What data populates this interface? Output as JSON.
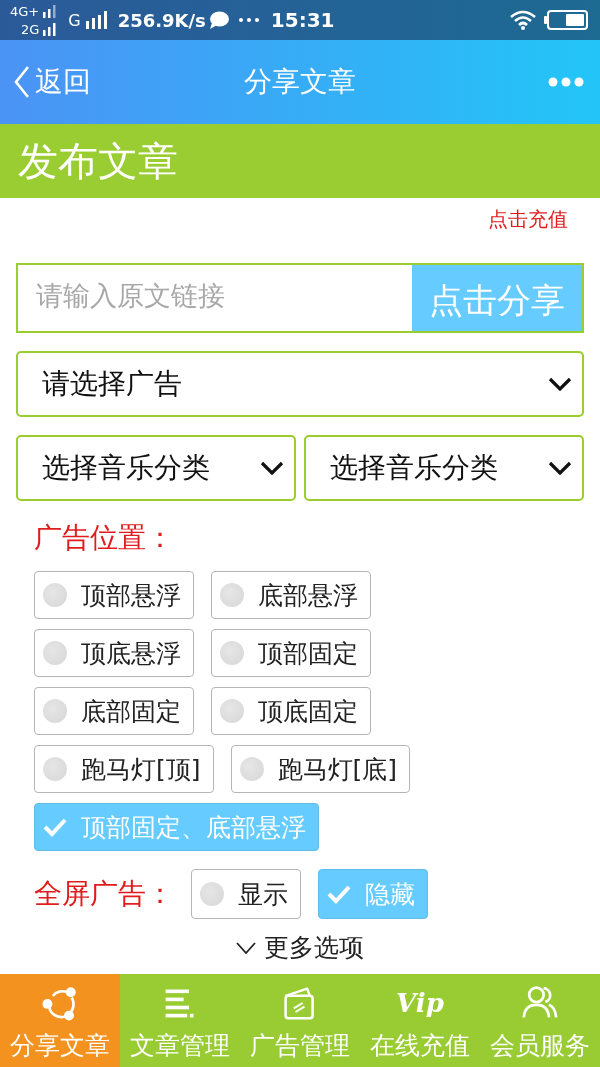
{
  "status_bar": {
    "network_top": "4G+",
    "network_bottom": "2G",
    "network_second": "G",
    "speed": "256.9K/s",
    "time": "15:31"
  },
  "nav_bar": {
    "back_label": "返回",
    "title": "分享文章"
  },
  "header": {
    "title": "发布文章"
  },
  "recharge_link": "点击充值",
  "share_form": {
    "url_field": {
      "placeholder": "请输入原文链接"
    },
    "share_button": "点击分享"
  },
  "ad_select": {
    "value": "请选择广告"
  },
  "music_selects": [
    {
      "value": "选择音乐分类"
    },
    {
      "value": "选择音乐分类"
    }
  ],
  "ad_position": {
    "label": "广告位置：",
    "options": [
      {
        "label": "顶部悬浮",
        "selected": false
      },
      {
        "label": "底部悬浮",
        "selected": false
      },
      {
        "label": "顶底悬浮",
        "selected": false
      },
      {
        "label": "顶部固定",
        "selected": false
      },
      {
        "label": "底部固定",
        "selected": false
      },
      {
        "label": "顶底固定",
        "selected": false
      },
      {
        "label": "跑马灯[顶]",
        "selected": false
      },
      {
        "label": "跑马灯[底]",
        "selected": false
      },
      {
        "label": "顶部固定、底部悬浮",
        "selected": true
      }
    ]
  },
  "fullscreen_ad": {
    "label": "全屏广告：",
    "options": [
      {
        "label": "显示",
        "selected": false
      },
      {
        "label": "隐藏",
        "selected": true
      }
    ]
  },
  "more_options": "更多选项",
  "tab_bar": [
    {
      "label": "分享文章",
      "selected": true
    },
    {
      "label": "文章管理",
      "selected": false
    },
    {
      "label": "广告管理",
      "selected": false
    },
    {
      "label": "在线充值",
      "selected": false,
      "icon_text": "Vip"
    },
    {
      "label": "会员服务",
      "selected": false
    }
  ]
}
